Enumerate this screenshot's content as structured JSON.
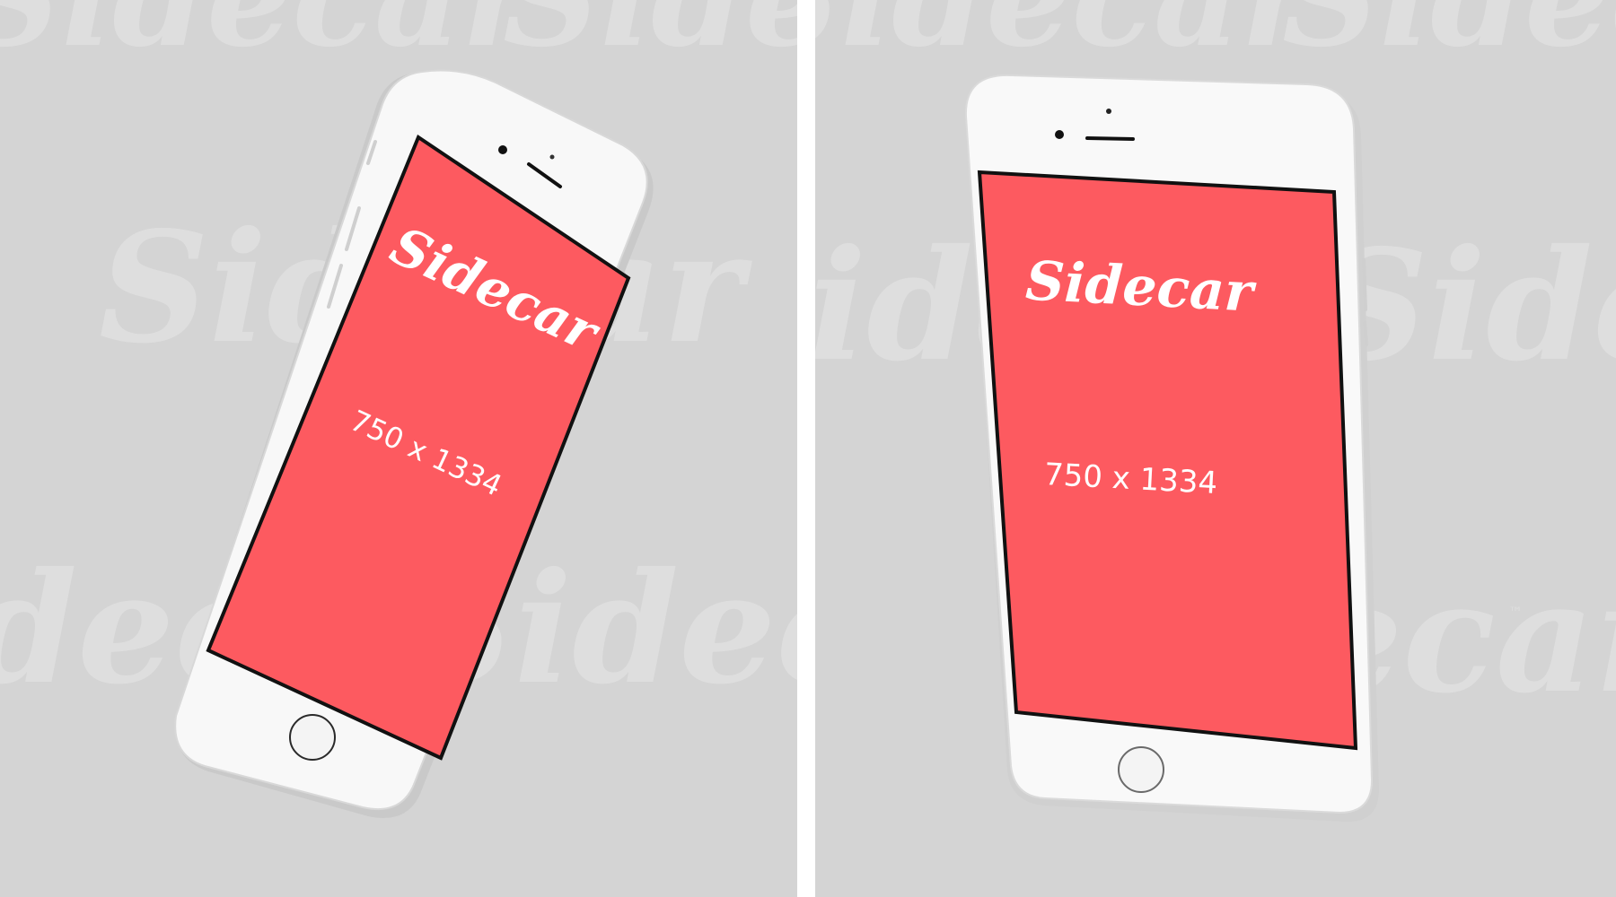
{
  "mockups": [
    {
      "brand": "Sidecar",
      "resolution": "750 x 1334"
    },
    {
      "brand": "Sidecar",
      "resolution": "750 x 1334"
    }
  ],
  "watermark": {
    "text": "Sidecar",
    "trademark": "™"
  },
  "colors": {
    "background": "#d4d4d4",
    "divider": "#ffffff",
    "screen": "#fd5a60",
    "phone_body": "#f7f7f7",
    "screen_border": "#111111"
  }
}
